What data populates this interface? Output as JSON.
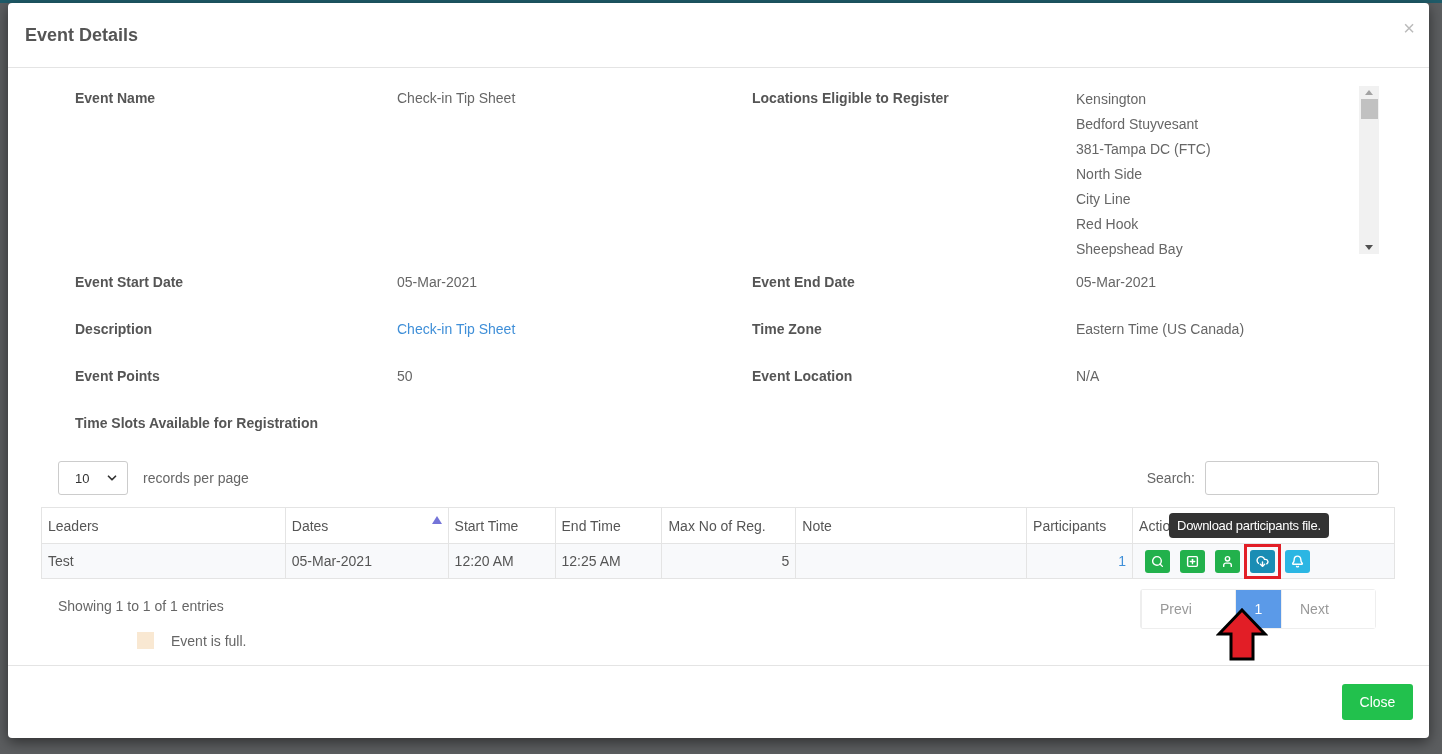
{
  "modal": {
    "title": "Event Details",
    "close_symbol": "×"
  },
  "details": [
    {
      "cells": [
        {
          "label": "Event Name",
          "kind": "text",
          "value": "Check-in Tip Sheet"
        },
        {
          "label": "Locations Eligible to Register",
          "kind": "list",
          "items": [
            "Kensington",
            "Bedford Stuyvesant",
            "381-Tampa DC (FTC)",
            "North Side",
            "City Line",
            "Red Hook",
            "Sheepshead Bay"
          ]
        }
      ]
    },
    {
      "cells": [
        {
          "label": "Event Start Date",
          "kind": "text",
          "value": "05-Mar-2021"
        },
        {
          "label": "Event End Date",
          "kind": "text",
          "value": "05-Mar-2021"
        }
      ]
    },
    {
      "cells": [
        {
          "label": "Description",
          "kind": "link",
          "value": "Check-in Tip Sheet"
        },
        {
          "label": "Time Zone",
          "kind": "text",
          "value": "Eastern Time (US Canada)"
        }
      ]
    },
    {
      "cells": [
        {
          "label": "Event Points",
          "kind": "text",
          "value": "50"
        },
        {
          "label": "Event Location",
          "kind": "text",
          "value": "N/A"
        }
      ]
    },
    {
      "cells": [
        {
          "label": "Time Slots Available for Registration",
          "kind": "heading"
        }
      ]
    }
  ],
  "controls": {
    "page_size": "10",
    "page_size_label": "records per page",
    "search_label": "Search:"
  },
  "table": {
    "columns": [
      {
        "label": "Leaders",
        "sorted": false
      },
      {
        "label": "Dates",
        "sorted": true
      },
      {
        "label": "Start Time",
        "sorted": false
      },
      {
        "label": "End Time",
        "sorted": false
      },
      {
        "label": "Max No of Reg.",
        "sorted": false
      },
      {
        "label": "Note",
        "sorted": false
      },
      {
        "label": "Participants",
        "sorted": false
      },
      {
        "label": "Actio",
        "sorted": false
      }
    ],
    "rows": [
      {
        "cells": [
          {
            "kind": "text",
            "text": "Test"
          },
          {
            "kind": "text",
            "text": "05-Mar-2021"
          },
          {
            "kind": "text",
            "text": "12:20 AM"
          },
          {
            "kind": "text",
            "text": "12:25 AM"
          },
          {
            "kind": "number",
            "text": "5"
          },
          {
            "kind": "text",
            "text": ""
          },
          {
            "kind": "link",
            "text": "1"
          },
          {
            "kind": "actions"
          }
        ],
        "actions": [
          {
            "kind": "view",
            "color": "#22b14c",
            "highlighted": false
          },
          {
            "kind": "add",
            "color": "#22b14c",
            "highlighted": false
          },
          {
            "kind": "user",
            "color": "#22b14c",
            "highlighted": false
          },
          {
            "kind": "download",
            "color": "#1a8db4",
            "highlighted": true
          },
          {
            "kind": "notify",
            "color": "#2bb6e3",
            "highlighted": false
          }
        ]
      }
    ]
  },
  "tooltip": "Download participants file.",
  "info": "Showing 1 to 1 of 1 entries",
  "legend": [
    {
      "label": "Event is full.",
      "color": "#f9e8d2"
    }
  ],
  "pagination": [
    {
      "label": "Previ",
      "selected": false,
      "disabled": true
    },
    {
      "label": "1",
      "selected": true,
      "disabled": false
    },
    {
      "label": "Next",
      "selected": false,
      "disabled": true
    }
  ],
  "footer": {
    "button": "Close"
  }
}
